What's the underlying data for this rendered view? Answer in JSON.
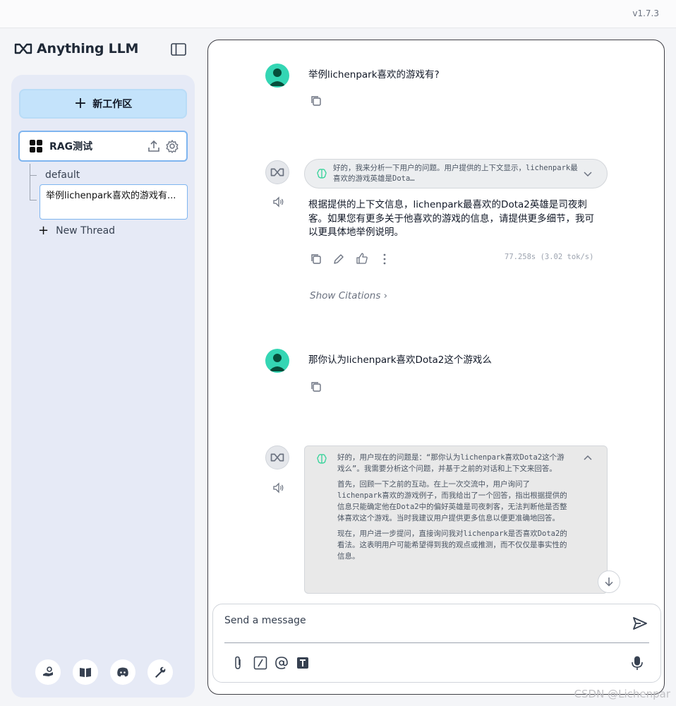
{
  "app": {
    "version": "v1.7.3",
    "logo_text": "Anything LLM"
  },
  "sidebar": {
    "new_workspace_label": "新工作区",
    "workspace": {
      "name": "RAG测试"
    },
    "threads": [
      {
        "label": "default"
      },
      {
        "label": "举例lichenpark喜欢的游戏有..."
      }
    ],
    "new_thread_label": "New Thread",
    "footer_icons": [
      "hand-coins-icon",
      "book-icon",
      "discord-icon",
      "wrench-icon"
    ]
  },
  "chat": {
    "messages": [
      {
        "role": "user",
        "text": "举例lichenpark喜欢的游戏有?"
      },
      {
        "role": "assistant",
        "thinking": "好的，我来分析一下用户的问题。用户提供的上下文显示，lichenpark最喜欢的游戏英雄是Dota…",
        "text": "根据提供的上下文信息，lichenpark最喜欢的Dota2英雄是司夜刺客。如果您有更多关于他喜欢的游戏的信息，请提供更多细节，我可以更具体地举例说明。",
        "stats": "77.258s (3.02 tok/s)",
        "citations_label": "Show Citations"
      },
      {
        "role": "user",
        "text": "那你认为lichenpark喜欢Dota2这个游戏么"
      },
      {
        "role": "assistant",
        "thinking_paragraphs": [
          "好的，用户现在的问题是：“那你认为lichenpark喜欢Dota2这个游戏么”。我需要分析这个问题，并基于之前的对话和上下文来回答。",
          "首先，回顾一下之前的互动。在上一次交流中，用户询问了lichenpark喜欢的游戏例子，而我给出了一个回答，指出根据提供的信息只能确定他在Dota2中的偏好英雄是司夜刺客，无法判断他是否整体喜欢这个游戏。当时我建议用户提供更多信息以便更准确地回答。",
          "现在，用户进一步提问，直接询问我对lichenpark是否喜欢Dota2的看法。这表明用户可能希望得到我的观点或推测，而不仅仅是事实性的信息。"
        ]
      }
    ],
    "composer": {
      "placeholder": "Send a message"
    }
  },
  "colors": {
    "accent": "#c4e3fb",
    "avatar_user": "#34d6b4",
    "sidebar_bg": "#e6eaf6"
  },
  "watermark": "CSDN @Lichenpar"
}
